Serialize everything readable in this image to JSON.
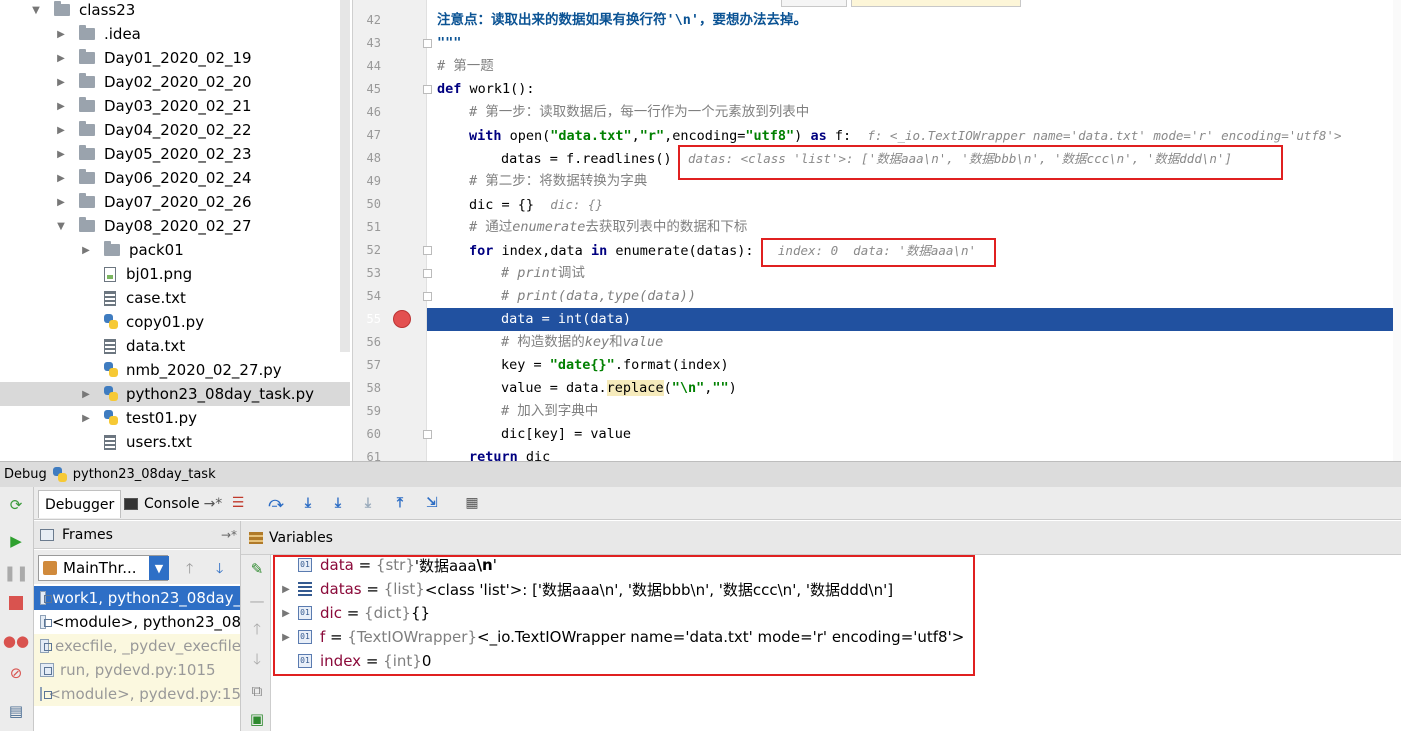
{
  "project_tree": {
    "items": [
      {
        "label": "class23",
        "kind": "folder",
        "arrow": "▼",
        "depth": 0
      },
      {
        "label": ".idea",
        "kind": "folder",
        "arrow": "▶",
        "depth": 1
      },
      {
        "label": "Day01_2020_02_19",
        "kind": "folder",
        "arrow": "▶",
        "depth": 1
      },
      {
        "label": "Day02_2020_02_20",
        "kind": "folder",
        "arrow": "▶",
        "depth": 1
      },
      {
        "label": "Day03_2020_02_21",
        "kind": "folder",
        "arrow": "▶",
        "depth": 1
      },
      {
        "label": "Day04_2020_02_22",
        "kind": "folder",
        "arrow": "▶",
        "depth": 1
      },
      {
        "label": "Day05_2020_02_23",
        "kind": "folder",
        "arrow": "▶",
        "depth": 1
      },
      {
        "label": "Day06_2020_02_24",
        "kind": "folder",
        "arrow": "▶",
        "depth": 1
      },
      {
        "label": "Day07_2020_02_26",
        "kind": "folder",
        "arrow": "▶",
        "depth": 1
      },
      {
        "label": "Day08_2020_02_27",
        "kind": "folder",
        "arrow": "▼",
        "depth": 1
      },
      {
        "label": "pack01",
        "kind": "folder",
        "arrow": "▶",
        "depth": 2
      },
      {
        "label": "bj01.png",
        "kind": "png",
        "arrow": "",
        "depth": 2
      },
      {
        "label": "case.txt",
        "kind": "txt",
        "arrow": "",
        "depth": 2
      },
      {
        "label": "copy01.py",
        "kind": "py",
        "arrow": "",
        "depth": 2
      },
      {
        "label": "data.txt",
        "kind": "txt",
        "arrow": "",
        "depth": 2
      },
      {
        "label": "nmb_2020_02_27.py",
        "kind": "py",
        "arrow": "",
        "depth": 2
      },
      {
        "label": "python23_08day_task.py",
        "kind": "py",
        "arrow": "▶",
        "depth": 2,
        "selected": true
      },
      {
        "label": "test01.py",
        "kind": "py",
        "arrow": "▶",
        "depth": 2
      },
      {
        "label": "users.txt",
        "kind": "txt",
        "arrow": "",
        "depth": 2
      }
    ]
  },
  "editor": {
    "line_numbers": [
      "42",
      "43",
      "44",
      "45",
      "46",
      "47",
      "48",
      "49",
      "50",
      "51",
      "52",
      "53",
      "54",
      "55",
      "56",
      "57",
      "58",
      "59",
      "60",
      "61"
    ],
    "breakpoint_line": "55",
    "lines": {
      "l42": "注意点：读取出来的数据如果有换行符'\\n'，要想办法去掉。",
      "l43": "\"\"\"",
      "l44": "# 第一题",
      "l45_kw": "def",
      "l45_rest": " work1():",
      "l46": "# 第一步：读取数据后，每一行作为一个元素放到列表中",
      "l47_kw1": "with",
      "l47_a": " open(",
      "l47_s1": "\"data.txt\"",
      "l47_b": ",",
      "l47_s2": "\"r\"",
      "l47_c": ",encoding=",
      "l47_s3": "\"utf8\"",
      "l47_d": ") ",
      "l47_kw2": "as",
      "l47_e": " f:",
      "l47_hint": "f: <_io.TextIOWrapper name='data.txt' mode='r' encoding='utf8'>",
      "l48_code": "datas = f.readlines()",
      "l48_hint": "datas: <class 'list'>: ['数据aaa\\n', '数据bbb\\n', '数据ccc\\n', '数据ddd\\n']",
      "l49": "# 第二步：将数据转换为字典",
      "l50_code": "dic = {}",
      "l50_hint": "dic: {}",
      "l51_a": "# 通过",
      "l51_it": "enumerate",
      "l51_b": "去获取列表中的数据和下标",
      "l52_kw1": "for",
      "l52_a": " index,data ",
      "l52_kw2": "in",
      "l52_b": " enumerate(datas):",
      "l52_hint": "index: 0  data: '数据aaa\\n'",
      "l53_a": "# print",
      "l53_b": "调试",
      "l54": "# print(data,type(data))",
      "l55": "data = int(data)",
      "l56_a": "# 构造数据的",
      "l56_it1": "key",
      "l56_b": "和",
      "l56_it2": "value",
      "l57_a": "key = ",
      "l57_s": "\"date{}\"",
      "l57_b": ".format(index)",
      "l58_a": "value = data.",
      "l58_b": "replace",
      "l58_c": "(",
      "l58_s1": "\"\\n\"",
      "l58_d": ",",
      "l58_s2": "\"\"",
      "l58_e": ")",
      "l59": "# 加入到字典中",
      "l60": "dic[key] = value",
      "l61_kw": "return",
      "l61_rest": " dic"
    }
  },
  "debug": {
    "window_label": "Debug",
    "config_name": "python23_08day_task",
    "tabs": {
      "debugger": "Debugger",
      "console": "Console"
    },
    "frames_header": "Frames",
    "variables_header": "Variables",
    "thread": "MainThr...",
    "frames": [
      {
        "label": "work1, python23_08day_",
        "style": "sel"
      },
      {
        "label": "<module>, python23_08",
        "style": "mod"
      },
      {
        "label": "execfile, _pydev_execfile",
        "style": "lib"
      },
      {
        "label": "run, pydevd.py:1015",
        "style": "lib"
      },
      {
        "label": "<module>, pydevd.py:15",
        "style": "lib"
      }
    ],
    "variables": [
      {
        "name": "data",
        "type": "{str}",
        "value_plain": " '数据aaa",
        "value_bold": "\\n",
        "value_tail": "'",
        "expandable": false,
        "icon": "01"
      },
      {
        "name": "datas",
        "type": "{list}",
        "value_plain": " <class 'list'>: ['数据aaa\\n', '数据bbb\\n', '数据ccc\\n', '数据ddd\\n']",
        "value_bold": "",
        "value_tail": "",
        "expandable": true,
        "icon": "list"
      },
      {
        "name": "dic",
        "type": "{dict}",
        "value_plain": " {}",
        "value_bold": "",
        "value_tail": "",
        "expandable": true,
        "icon": "01"
      },
      {
        "name": "f",
        "type": "{TextIOWrapper}",
        "value_plain": " <_io.TextIOWrapper name='data.txt' mode='r' encoding='utf8'>",
        "value_bold": "",
        "value_tail": "",
        "expandable": true,
        "icon": "01"
      },
      {
        "name": "index",
        "type": "{int}",
        "value_plain": " 0",
        "value_bold": "",
        "value_tail": "",
        "expandable": false,
        "icon": "01"
      }
    ]
  },
  "colors": {
    "current_line": "#2151a0",
    "selection_blue": "#2e6fc6",
    "highlight_red": "#e02020",
    "breakpoint": "#e35050"
  }
}
